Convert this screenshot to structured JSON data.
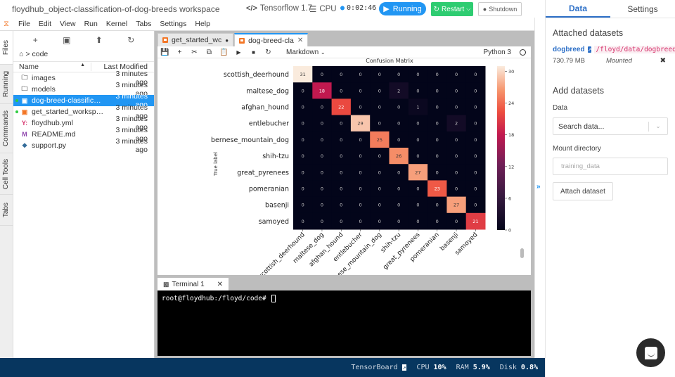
{
  "header": {
    "workspace_title": "floydhub_object-classification-of-dog-breeds workspace",
    "environment": "Tensorflow 1.7",
    "machine": "CPU",
    "timer": "0:02:46",
    "running_label": "Running",
    "restart_label": "Restart",
    "shutdown_label": "Shutdown"
  },
  "menu": [
    "File",
    "Edit",
    "View",
    "Run",
    "Kernel",
    "Tabs",
    "Settings",
    "Help"
  ],
  "left_tabs": [
    "Files",
    "Running",
    "Commands",
    "Cell Tools",
    "Tabs"
  ],
  "file_browser": {
    "breadcrumb": "code",
    "columns": {
      "name": "Name",
      "modified": "Last Modified"
    },
    "files": [
      {
        "name": "images",
        "modified": "3 minutes ago",
        "type": "folder",
        "running": false,
        "selected": false
      },
      {
        "name": "models",
        "modified": "3 minutes ago",
        "type": "folder",
        "running": false,
        "selected": false
      },
      {
        "name": "dog-breed-classificat...",
        "modified": "3 minutes ago",
        "type": "notebook",
        "running": true,
        "selected": true
      },
      {
        "name": "get_started_workspac...",
        "modified": "3 minutes ago",
        "type": "notebook",
        "running": true,
        "selected": false
      },
      {
        "name": "floydhub.yml",
        "modified": "3 minutes ago",
        "type": "yaml",
        "running": false,
        "selected": false
      },
      {
        "name": "README.md",
        "modified": "3 minutes ago",
        "type": "markdown",
        "running": false,
        "selected": false
      },
      {
        "name": "support.py",
        "modified": "3 minutes ago",
        "type": "python",
        "running": false,
        "selected": false
      }
    ]
  },
  "notebook_tabs": [
    {
      "label": "get_started_wc",
      "active": false,
      "modified": true
    },
    {
      "label": "dog-breed-cla",
      "active": true,
      "modified": false
    }
  ],
  "notebook_toolbar": {
    "cell_type": "Markdown",
    "kernel": "Python 3"
  },
  "chart_data": {
    "type": "heatmap",
    "title": "Confusion Matrix",
    "ylabel": "True label",
    "xlabel": "",
    "categories": [
      "scottish_deerhound",
      "maltese_dog",
      "afghan_hound",
      "entlebucher",
      "bernese_mountain_dog",
      "shih-tzu",
      "great_pyrenees",
      "pomeranian",
      "basenji",
      "samoyed"
    ],
    "x_tick_labels_visible": [
      "scottish_deerhound",
      "maltese_dog",
      "afghan_hound",
      "entlebucher",
      "bernese_mountain_dog",
      "shih-tzu",
      "great_pyrenees",
      "pomeranian",
      "basenji",
      "samoyed"
    ],
    "matrix": [
      [
        31,
        0,
        0,
        0,
        0,
        0,
        0,
        0,
        0,
        0
      ],
      [
        0,
        18,
        0,
        0,
        0,
        2,
        0,
        0,
        0,
        0
      ],
      [
        0,
        0,
        22,
        0,
        0,
        0,
        1,
        0,
        0,
        0
      ],
      [
        0,
        0,
        0,
        29,
        0,
        0,
        0,
        0,
        2,
        0
      ],
      [
        0,
        0,
        0,
        0,
        25,
        0,
        0,
        0,
        0,
        0
      ],
      [
        0,
        0,
        0,
        0,
        0,
        26,
        0,
        0,
        0,
        0
      ],
      [
        0,
        0,
        0,
        0,
        0,
        0,
        27,
        0,
        0,
        0
      ],
      [
        0,
        0,
        0,
        0,
        0,
        0,
        0,
        23,
        0,
        0
      ],
      [
        0,
        0,
        0,
        0,
        0,
        0,
        0,
        0,
        27,
        0
      ],
      [
        0,
        0,
        0,
        0,
        0,
        0,
        0,
        0,
        0,
        21
      ]
    ],
    "colorbar": {
      "min": 0,
      "max": 31,
      "ticks": [
        0,
        6,
        12,
        18,
        24,
        30
      ],
      "colormap": "rocket"
    }
  },
  "terminal": {
    "tab_label": "Terminal 1",
    "prompt": "root@floydhub:/floyd/code#"
  },
  "statusbar": {
    "tensorboard": "TensorBoard",
    "cpu_label": "CPU",
    "cpu_value": "10%",
    "ram_label": "RAM",
    "ram_value": "5.9%",
    "disk_label": "Disk",
    "disk_value": "0.8%"
  },
  "right_panel": {
    "tabs": [
      "Data",
      "Settings"
    ],
    "attached_title": "Attached datasets",
    "dataset": {
      "name": "dogbreed",
      "path": "/floyd/data/dogbreed",
      "size": "730.79 MB",
      "status": "Mounted"
    },
    "add_title": "Add datasets",
    "data_label": "Data",
    "data_placeholder": "Search data...",
    "mount_label": "Mount directory",
    "mount_placeholder": "training_data",
    "attach_button": "Attach dataset"
  },
  "colors": {
    "accent": "#2196f3",
    "restart_green": "#2ecc71",
    "status_bar": "#07365f",
    "dataset_link": "#2c6fc7",
    "path_red": "#d6336c"
  }
}
